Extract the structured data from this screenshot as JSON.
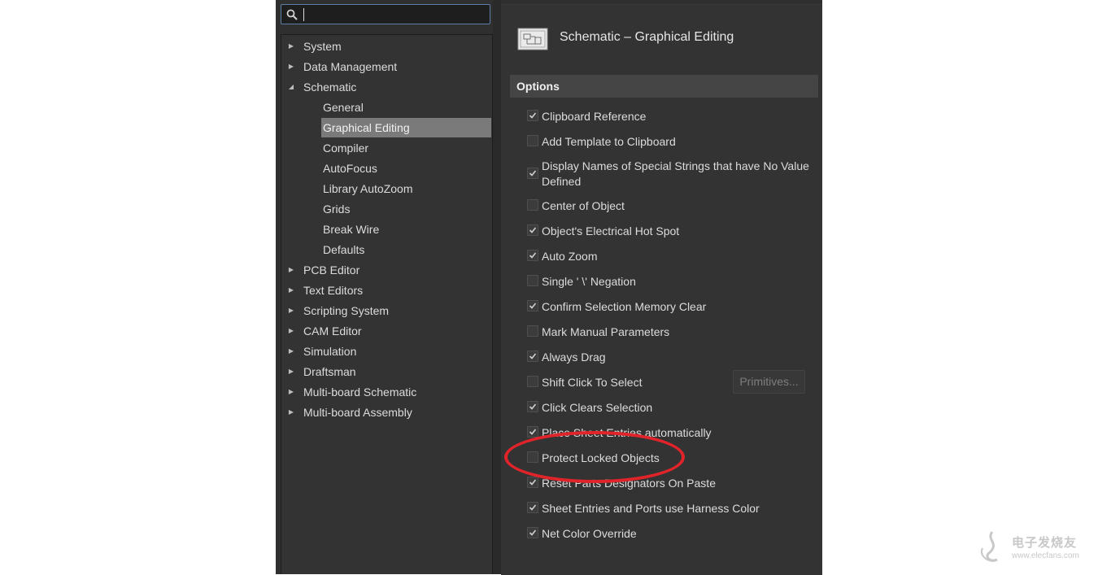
{
  "search": {
    "value": ""
  },
  "tree": {
    "items": [
      {
        "label": "System",
        "level": 0,
        "expander": "collapsed"
      },
      {
        "label": "Data Management",
        "level": 0,
        "expander": "collapsed"
      },
      {
        "label": "Schematic",
        "level": 0,
        "expander": "expanded"
      },
      {
        "label": "General",
        "level": 1
      },
      {
        "label": "Graphical Editing",
        "level": 1,
        "selected": true
      },
      {
        "label": "Compiler",
        "level": 1
      },
      {
        "label": "AutoFocus",
        "level": 1
      },
      {
        "label": "Library AutoZoom",
        "level": 1
      },
      {
        "label": "Grids",
        "level": 1
      },
      {
        "label": "Break Wire",
        "level": 1
      },
      {
        "label": "Defaults",
        "level": 1
      },
      {
        "label": "PCB Editor",
        "level": 0,
        "expander": "collapsed"
      },
      {
        "label": "Text Editors",
        "level": 0,
        "expander": "collapsed"
      },
      {
        "label": "Scripting System",
        "level": 0,
        "expander": "collapsed"
      },
      {
        "label": "CAM Editor",
        "level": 0,
        "expander": "collapsed"
      },
      {
        "label": "Simulation",
        "level": 0,
        "expander": "collapsed"
      },
      {
        "label": "Draftsman",
        "level": 0,
        "expander": "collapsed"
      },
      {
        "label": "Multi-board Schematic",
        "level": 0,
        "expander": "collapsed"
      },
      {
        "label": "Multi-board Assembly",
        "level": 0,
        "expander": "collapsed"
      }
    ]
  },
  "page": {
    "title": "Schematic – Graphical Editing",
    "icon": "schematic-page-icon"
  },
  "section": {
    "title": "Options"
  },
  "options": [
    {
      "label": "Clipboard Reference",
      "checked": true
    },
    {
      "label": "Add Template to Clipboard",
      "checked": false
    },
    {
      "label": "Display Names of Special Strings that have No Value Defined",
      "checked": true
    },
    {
      "label": "Center of Object",
      "checked": false
    },
    {
      "label": "Object's Electrical Hot Spot",
      "checked": true
    },
    {
      "label": "Auto Zoom",
      "checked": true
    },
    {
      "label": "Single ' \\' Negation",
      "checked": false
    },
    {
      "label": "Confirm Selection Memory Clear",
      "checked": true
    },
    {
      "label": "Mark Manual Parameters",
      "checked": false
    },
    {
      "label": "Always Drag",
      "checked": true
    },
    {
      "label": "Shift Click To Select",
      "checked": false
    },
    {
      "label": "Click Clears Selection",
      "checked": true
    },
    {
      "label": "Place Sheet Entries automatically",
      "checked": true
    },
    {
      "label": "Protect Locked Objects",
      "checked": false
    },
    {
      "label": "Reset Parts Designators On Paste",
      "checked": true
    },
    {
      "label": "Sheet Entries and Ports use Harness Color",
      "checked": true
    },
    {
      "label": "Net Color Override",
      "checked": true
    }
  ],
  "primitives_button": {
    "label": "Primitives...",
    "enabled": false
  },
  "annotation": {
    "color": "#e0242a",
    "highlights": "Protect Locked Objects"
  },
  "watermark": {
    "text": "电子发烧友",
    "url": "www.elecfans.com"
  }
}
